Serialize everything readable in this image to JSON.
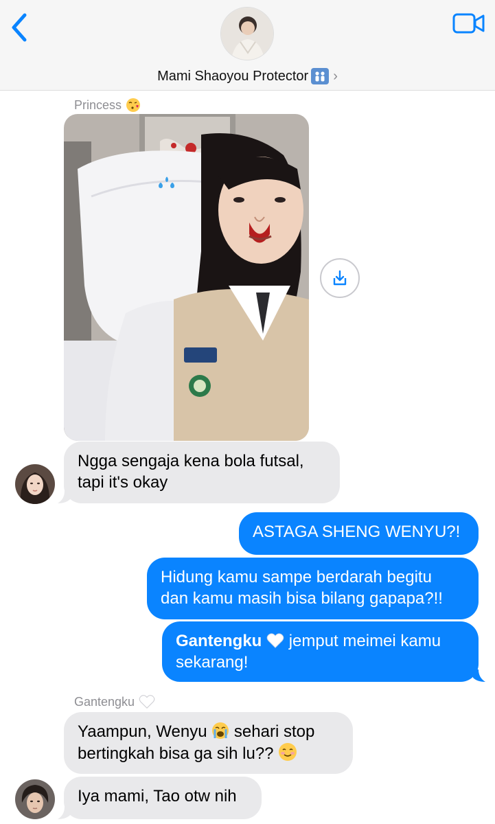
{
  "header": {
    "contact_name": "Mami Shaoyou Protector",
    "contact_emoji": "family-emoji",
    "accent_color": "#0a84ff"
  },
  "thread": {
    "label_princess": "Princess",
    "label_princess_emoji": "kissing-face-emoji",
    "label_gantengku": "Gantengku",
    "label_gantengku_emoji": "white-heart-emoji",
    "photo_icon": "download-icon",
    "msg1_line1": "Ngga sengaja kena bola futsal,",
    "msg1_line2": "tapi it's okay",
    "msg2": "ASTAGA SHENG WENYU?!",
    "msg3_line1": "Hidung kamu sampe berdarah begitu",
    "msg3_line2": "dan kamu masih bisa bilang gapapa?!!",
    "msg4_mention": "Gantengku",
    "msg4_rest1": "jemput meimei kamu",
    "msg4_line2": "sekarang!",
    "msg5_line1a": "Yaampun, Wenyu",
    "msg5_line1b": "sehari stop",
    "msg5_line2": "bertingkah bisa ga sih lu??",
    "msg6": "Iya mami, Tao otw nih"
  },
  "colors": {
    "incoming_bubble": "#e9e9eb",
    "outgoing_bubble": "#0a84ff",
    "label_gray": "#8e8e93"
  }
}
